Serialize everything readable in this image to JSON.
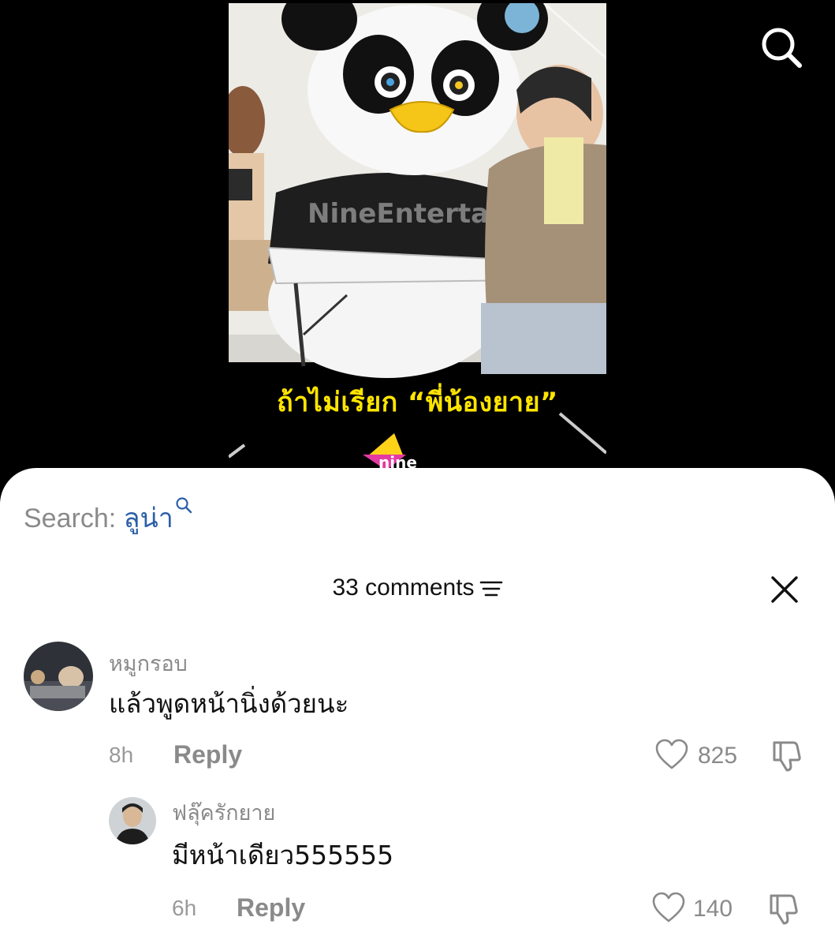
{
  "video": {
    "subtitle": "ถ้าไม่เรียก “พี่น้องยาย”",
    "watermark": "nine",
    "shirt_text": "NineEntertain"
  },
  "top_bar": {
    "search_icon": "search-icon"
  },
  "comments_sheet": {
    "search_label": "Search: ",
    "search_term": "ลูน่า",
    "header_title": "33 comments",
    "filter_icon": "filter-icon",
    "close_icon": "close-icon",
    "comments": [
      {
        "username": "หมูกรอบ",
        "text": "แล้วพูดหน้านิ่งด้วยนะ",
        "time": "8h",
        "reply_label": "Reply",
        "likes": "825"
      },
      {
        "username": "ฟลุ๊ครักยาย",
        "text": "มีหน้าเดียว555555",
        "time": "6h",
        "reply_label": "Reply",
        "likes": "140"
      }
    ]
  },
  "colors": {
    "subtitle": "#ffe500",
    "search_term": "#2c5fa8",
    "muted_text": "#8a8a8a",
    "sheet_bg": "#ffffff",
    "page_bg": "#000000"
  }
}
